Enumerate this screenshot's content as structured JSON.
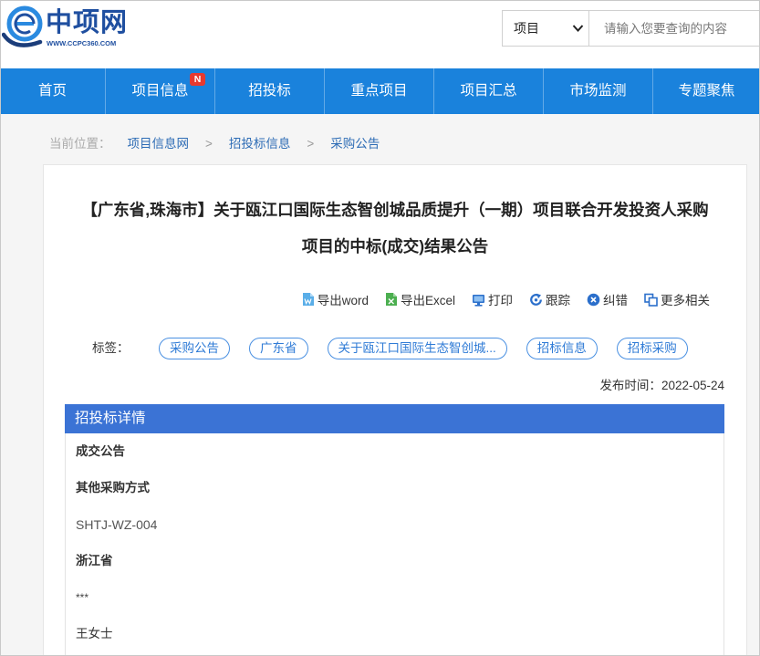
{
  "colors": {
    "nav_bg": "#1a82dc",
    "detail_header_bg": "#3b73d5",
    "tag_border": "#4a90e2",
    "tag_text": "#2f7bd6",
    "link": "#2d6cb5",
    "badge_bg": "#e8392f",
    "logo": "#1f4fa0"
  },
  "header": {
    "logo": {
      "name": "中项网",
      "site": "WWW.CCPC360.COM",
      "icon": "globe-logo-icon"
    },
    "search": {
      "category": "项目",
      "placeholder": "请输入您要查询的内容",
      "icon": "chevron-down-icon"
    }
  },
  "nav": {
    "items": [
      {
        "label": "首页"
      },
      {
        "label": "项目信息",
        "badge": "N"
      },
      {
        "label": "招投标"
      },
      {
        "label": "重点项目"
      },
      {
        "label": "项目汇总"
      },
      {
        "label": "市场监测"
      },
      {
        "label": "专题聚焦"
      }
    ]
  },
  "breadcrumb": {
    "prefix": "当前位置：",
    "separator": ">",
    "items": [
      "项目信息网",
      "招投标信息",
      "采购公告"
    ]
  },
  "article": {
    "title_lines": [
      "【广东省,珠海市】关于瓯江口国际生态智创城品质提升（一期）项目联合开发投资人采购",
      "项目的中标(成交)结果公告"
    ],
    "toolbar": [
      {
        "label": "导出word",
        "icon": "word-file-icon"
      },
      {
        "label": "导出Excel",
        "icon": "excel-file-icon"
      },
      {
        "label": "打印",
        "icon": "print-icon"
      },
      {
        "label": "跟踪",
        "icon": "track-icon"
      },
      {
        "label": "纠错",
        "icon": "error-report-icon"
      },
      {
        "label": "更多相关",
        "icon": "related-icon"
      }
    ],
    "tags_label": "标签：",
    "tags": [
      "采购公告",
      "广东省",
      "关于瓯江口国际生态智创城...",
      "招标信息",
      "招标采购"
    ],
    "publish_label": "发布时间：",
    "publish_date": "2022-05-24"
  },
  "details": {
    "heading": "招投标详情",
    "rows": [
      "成交公告",
      "其他采购方式",
      "SHTJ-WZ-004",
      "浙江省",
      "***",
      "王女士"
    ]
  }
}
